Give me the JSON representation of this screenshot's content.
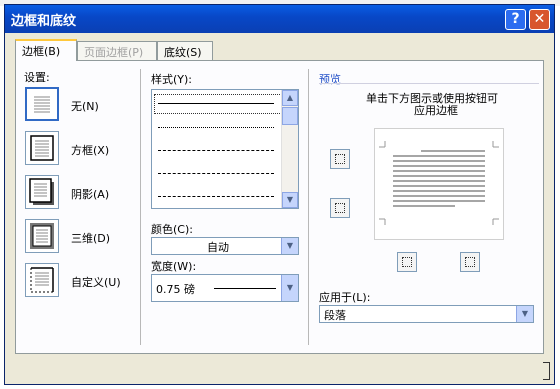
{
  "window": {
    "title": "边框和底纹",
    "help_label": "?",
    "close_label": "✕"
  },
  "tabs": [
    {
      "label": "边框(B)"
    },
    {
      "label": "页面边框(P)"
    },
    {
      "label": "底纹(S)"
    }
  ],
  "settings": {
    "heading": "设置:",
    "items": [
      {
        "label": "无(N)"
      },
      {
        "label": "方框(X)"
      },
      {
        "label": "阴影(A)"
      },
      {
        "label": "三维(D)"
      },
      {
        "label": "自定义(U)"
      }
    ]
  },
  "style": {
    "heading": "样式(Y):",
    "color_label": "颜色(C):",
    "color_value": "自动",
    "width_label": "宽度(W):",
    "width_value": "0.75 磅"
  },
  "preview": {
    "heading": "预览",
    "hint_line1": "单击下方图示或使用按钮可",
    "hint_line2": "应用边框",
    "apply_label": "应用于(L):",
    "apply_value": "段落"
  }
}
